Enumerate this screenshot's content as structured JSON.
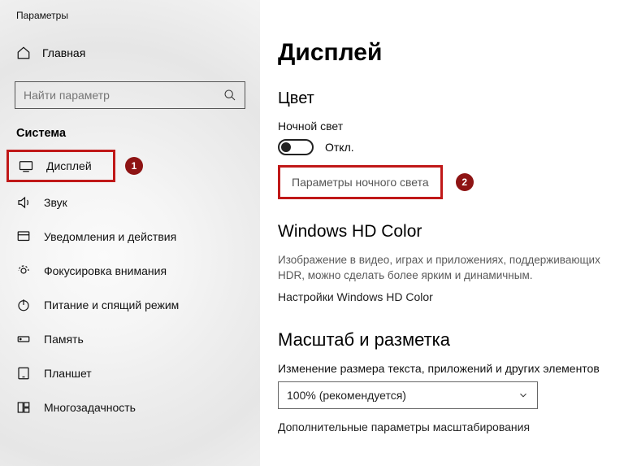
{
  "app_title": "Параметры",
  "home_label": "Главная",
  "search_placeholder": "Найти параметр",
  "section_label": "Система",
  "nav": {
    "display": "Дисплей",
    "sound": "Звук",
    "notifications": "Уведомления и действия",
    "focus": "Фокусировка внимания",
    "power": "Питание и спящий режим",
    "storage": "Память",
    "tablet": "Планшет",
    "multitask": "Многозадачность"
  },
  "callouts": {
    "one": "1",
    "two": "2"
  },
  "page": {
    "title": "Дисплей",
    "color_heading": "Цвет",
    "night_light_label": "Ночной свет",
    "toggle_state": "Откл.",
    "night_light_settings": "Параметры ночного света",
    "hd_heading": "Windows HD Color",
    "hd_desc": "Изображение в видео, играх и приложениях, поддерживающих HDR, можно сделать более ярким и динамичным.",
    "hd_link": "Настройки Windows HD Color",
    "scale_heading": "Масштаб и разметка",
    "scale_label": "Изменение размера текста, приложений и других элементов",
    "scale_value": "100% (рекомендуется)",
    "scale_advanced": "Дополнительные параметры масштабирования"
  }
}
